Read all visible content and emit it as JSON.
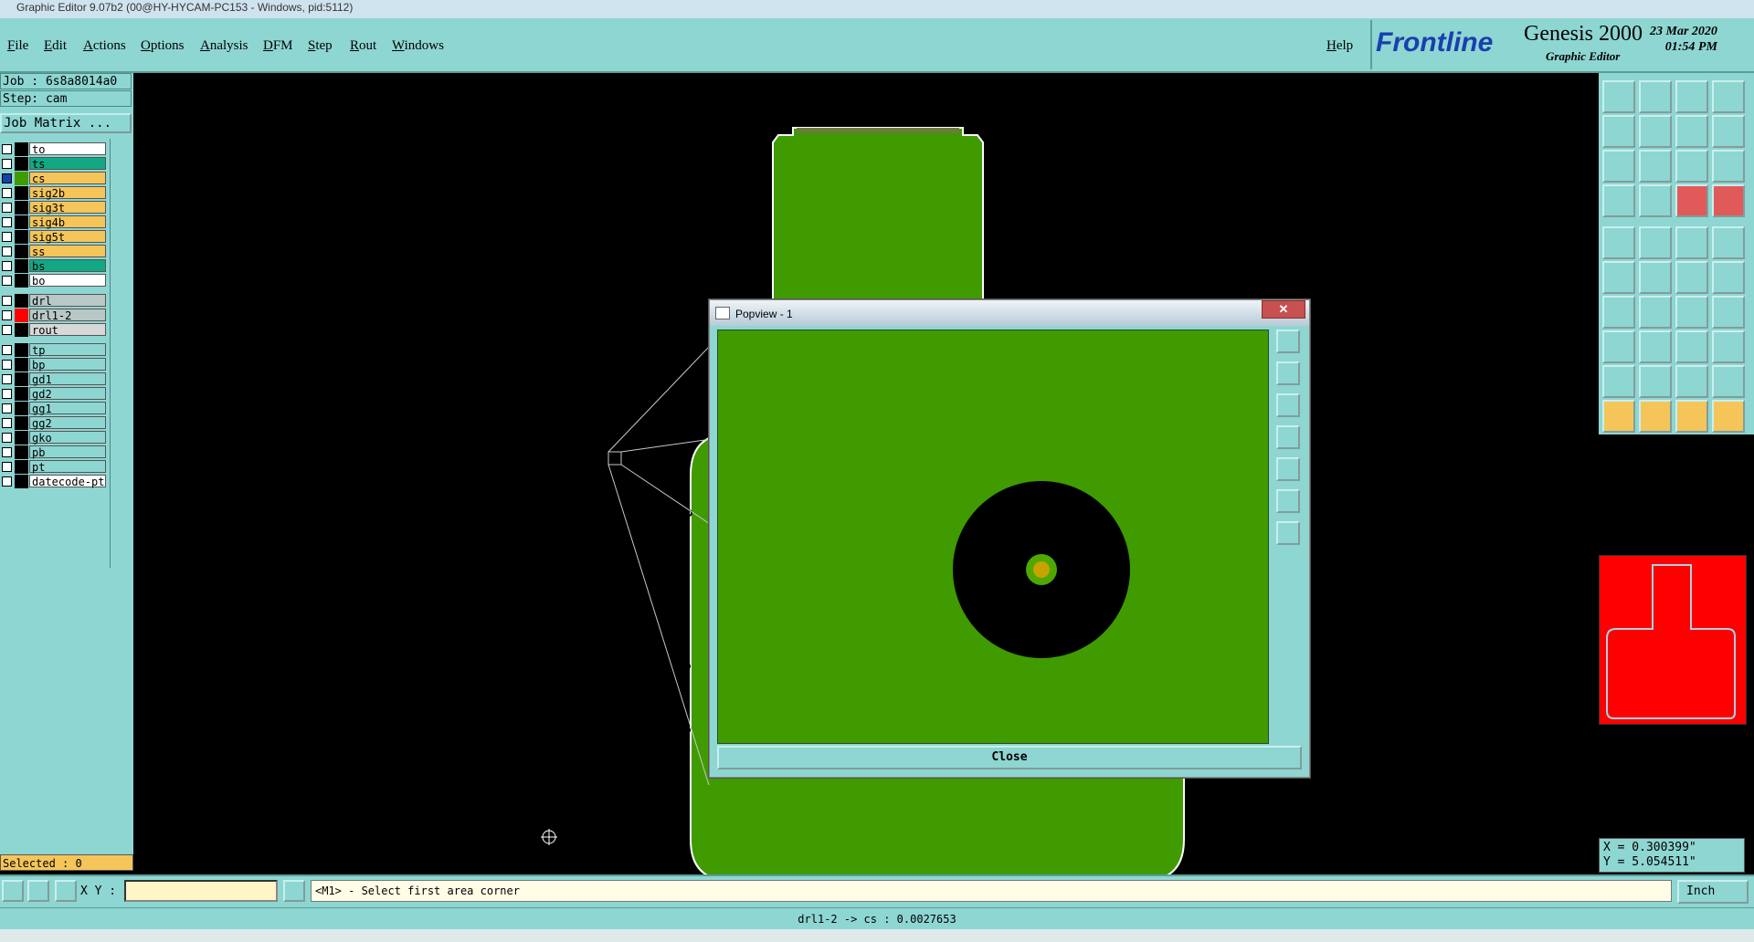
{
  "window": {
    "title": "Graphic Editor 9.07b2 (00@HY-HYCAM-PC153 - Windows, pid:5112)"
  },
  "menu": {
    "items": [
      "File",
      "Edit",
      "Actions",
      "Options",
      "Analysis",
      "DFM",
      "Step",
      "Rout",
      "Windows"
    ],
    "help": "Help"
  },
  "brand": {
    "company": "Frontline",
    "product": "Genesis 2000",
    "subtitle": "Graphic Editor",
    "date": "23 Mar 2020",
    "time": "01:54 PM"
  },
  "job": {
    "job_line": "Job : 6s8a8014a0",
    "step_line": "Step: cam",
    "matrix_button": "Job Matrix ..."
  },
  "layers": [
    {
      "name": "to",
      "color": "#ffffff",
      "swatch": "#000000"
    },
    {
      "name": "ts",
      "color": "#12a884",
      "swatch": "#000000"
    },
    {
      "name": "cs",
      "color": "#f5c55a",
      "swatch": "#3f9b00",
      "checked": true
    },
    {
      "name": "sig2b",
      "color": "#f5c55a",
      "swatch": "#000000"
    },
    {
      "name": "sig3t",
      "color": "#f5c55a",
      "swatch": "#000000"
    },
    {
      "name": "sig4b",
      "color": "#f5c55a",
      "swatch": "#000000"
    },
    {
      "name": "sig5t",
      "color": "#f5c55a",
      "swatch": "#000000"
    },
    {
      "name": "ss",
      "color": "#f5c55a",
      "swatch": "#000000"
    },
    {
      "name": "bs",
      "color": "#12a884",
      "swatch": "#000000"
    },
    {
      "name": "bo",
      "color": "#ffffff",
      "swatch": "#000000"
    },
    {
      "name": "drl",
      "color": "#b9c7c7",
      "swatch": "#000000"
    },
    {
      "name": "drl1-2",
      "color": "#b9c7c7",
      "swatch": "#ff0000"
    },
    {
      "name": "rout",
      "color": "#d8d8d8",
      "swatch": "#000000"
    },
    {
      "name": "tp",
      "color": "#8ed6d2",
      "swatch": "#000000"
    },
    {
      "name": "bp",
      "color": "#8ed6d2",
      "swatch": "#000000"
    },
    {
      "name": "gd1",
      "color": "#8ed6d2",
      "swatch": "#000000"
    },
    {
      "name": "gd2",
      "color": "#8ed6d2",
      "swatch": "#000000"
    },
    {
      "name": "gg1",
      "color": "#8ed6d2",
      "swatch": "#000000"
    },
    {
      "name": "gg2",
      "color": "#8ed6d2",
      "swatch": "#000000"
    },
    {
      "name": "gko",
      "color": "#8ed6d2",
      "swatch": "#000000"
    },
    {
      "name": "pb",
      "color": "#8ed6d2",
      "swatch": "#000000"
    },
    {
      "name": "pt",
      "color": "#8ed6d2",
      "swatch": "#000000"
    },
    {
      "name": "datecode-pt",
      "color": "#ffffff",
      "swatch": "#000000"
    }
  ],
  "selected": "Selected : 0",
  "popview": {
    "title": "Popview - 1",
    "close_label": "Close",
    "close_x": "✕"
  },
  "coords": {
    "x": "X = 0.300399\"",
    "y": "Y = 5.054511\""
  },
  "bottom": {
    "xy_label": "X Y :",
    "xy_value": "",
    "prompt": "<M1> - Select first area corner",
    "units": "Inch",
    "status": "drl1-2 -> cs : 0.0027653"
  },
  "colors": {
    "board": "#3f9b00",
    "panel": "#8ed6d2",
    "highlight": "#f5c55a",
    "minimap": "#ff0000"
  }
}
